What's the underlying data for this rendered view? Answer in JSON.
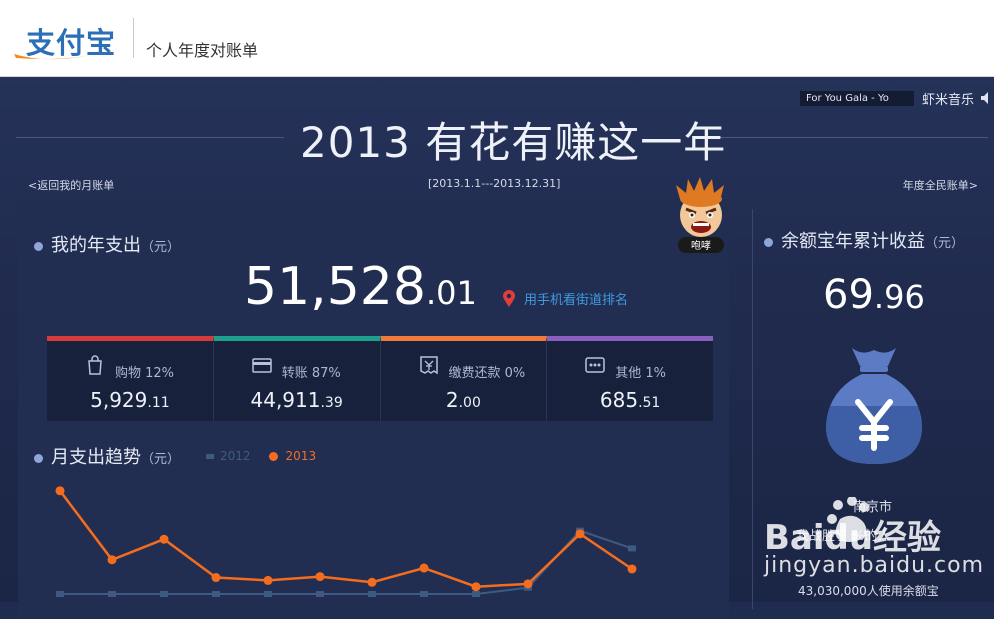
{
  "header": {
    "logo_text": "支付宝",
    "subtitle": "个人年度对账单"
  },
  "music": {
    "track": "For You    Gala - Yo",
    "brand": "虾米音乐",
    "icon": "speaker-icon"
  },
  "page": {
    "title": "2013 有花有赚这一年",
    "back_link": "<返回我的月账单",
    "date_range": "[2013.1.1---2013.12.31]",
    "national_link": "年度全民账单>"
  },
  "mascot": {
    "badge": "咆哮"
  },
  "annual_spend": {
    "heading": "我的年支出",
    "unit": "（元）",
    "amount_int": "51,528",
    "amount_dec": ".01",
    "rank_link": "用手机看街道排名"
  },
  "categories": [
    {
      "label": "购物 12%",
      "int": "5,929",
      "dec": ".11",
      "color": "#d63b3b",
      "icon": "shopping-bag-icon"
    },
    {
      "label": "转账 87%",
      "int": "44,911",
      "dec": ".39",
      "color": "#1fa08c",
      "icon": "card-icon"
    },
    {
      "label": "缴费还款 0%",
      "int": "2",
      "dec": ".00",
      "color": "#ef7a3a",
      "icon": "bill-icon"
    },
    {
      "label": "其他 1%",
      "int": "685",
      "dec": ".51",
      "color": "#8a5fc0",
      "icon": "more-icon"
    }
  ],
  "trend": {
    "heading": "月支出趋势",
    "unit": "（元）"
  },
  "chart_data": {
    "type": "line",
    "x": [
      1,
      2,
      3,
      4,
      5,
      6,
      7,
      8,
      9,
      10,
      11,
      12
    ],
    "series": [
      {
        "name": "2012",
        "color": "#3f5a82",
        "values": [
          0,
          0,
          0,
          0,
          0,
          0,
          0,
          0,
          0,
          100,
          1000,
          720
        ]
      },
      {
        "name": "2013",
        "color": "#f46d1f",
        "values": [
          1630,
          540,
          865,
          260,
          215,
          275,
          185,
          410,
          115,
          160,
          950,
          395
        ]
      }
    ],
    "ylim": [
      0,
      1800
    ]
  },
  "yuebao": {
    "heading": "余额宝年累计收益",
    "unit": "（元）",
    "amount_int": "69",
    "amount_dec": ".96",
    "city": "南京市",
    "beat": "我战胜了        %的人",
    "users": "43,030,000人使用余额宝"
  },
  "watermark": {
    "brand": "Baidu经验",
    "url": "jingyan.baidu.com"
  }
}
